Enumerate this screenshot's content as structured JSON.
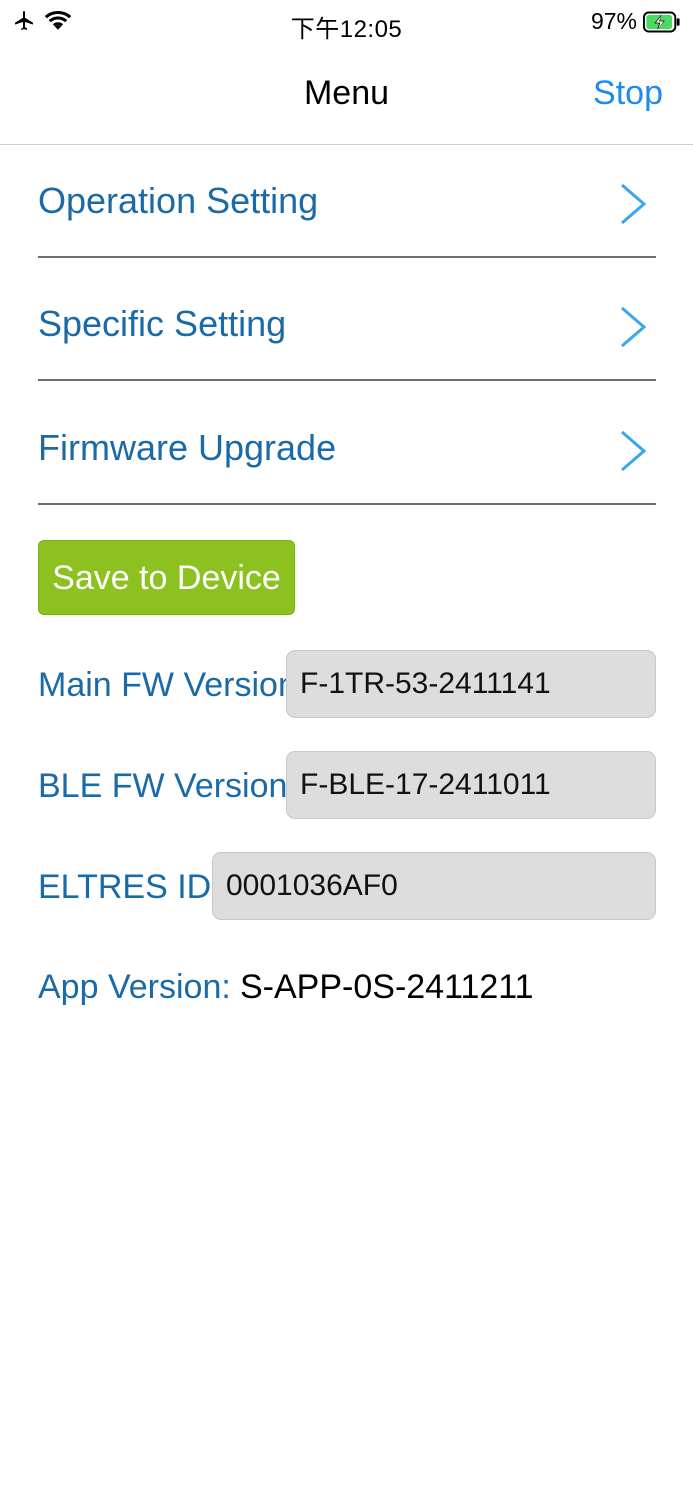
{
  "status_bar": {
    "time": "下午12:05",
    "battery_percent_text": "97%",
    "battery_level": 0.97,
    "icons": [
      "airplane-icon",
      "wifi-icon",
      "battery-charging-icon"
    ]
  },
  "nav": {
    "title": "Menu",
    "stop_label": "Stop"
  },
  "menu": {
    "items": [
      {
        "label": "Operation Setting"
      },
      {
        "label": "Specific Setting"
      },
      {
        "label": "Firmware Upgrade"
      }
    ],
    "chevron_icon": "chevron-right-icon"
  },
  "actions": {
    "save_label": "Save to Device"
  },
  "info": {
    "main_fw_label": "Main FW Version:",
    "main_fw_value": "F-1TR-53-2411141",
    "ble_fw_label": "BLE FW Version:",
    "ble_fw_value": "F-BLE-17-2411011",
    "eltres_label": "ELTRES ID:",
    "eltres_value": "0001036AF0",
    "app_version_label": "App Version:",
    "app_version_value": "S-APP-0S-2411211"
  },
  "colors": {
    "accent_blue": "#1d8cf0",
    "label_blue": "#1b6aa8",
    "save_green": "#8cc11f",
    "chevron_blue": "#3aa8e8",
    "battery_green": "#4cd964"
  }
}
